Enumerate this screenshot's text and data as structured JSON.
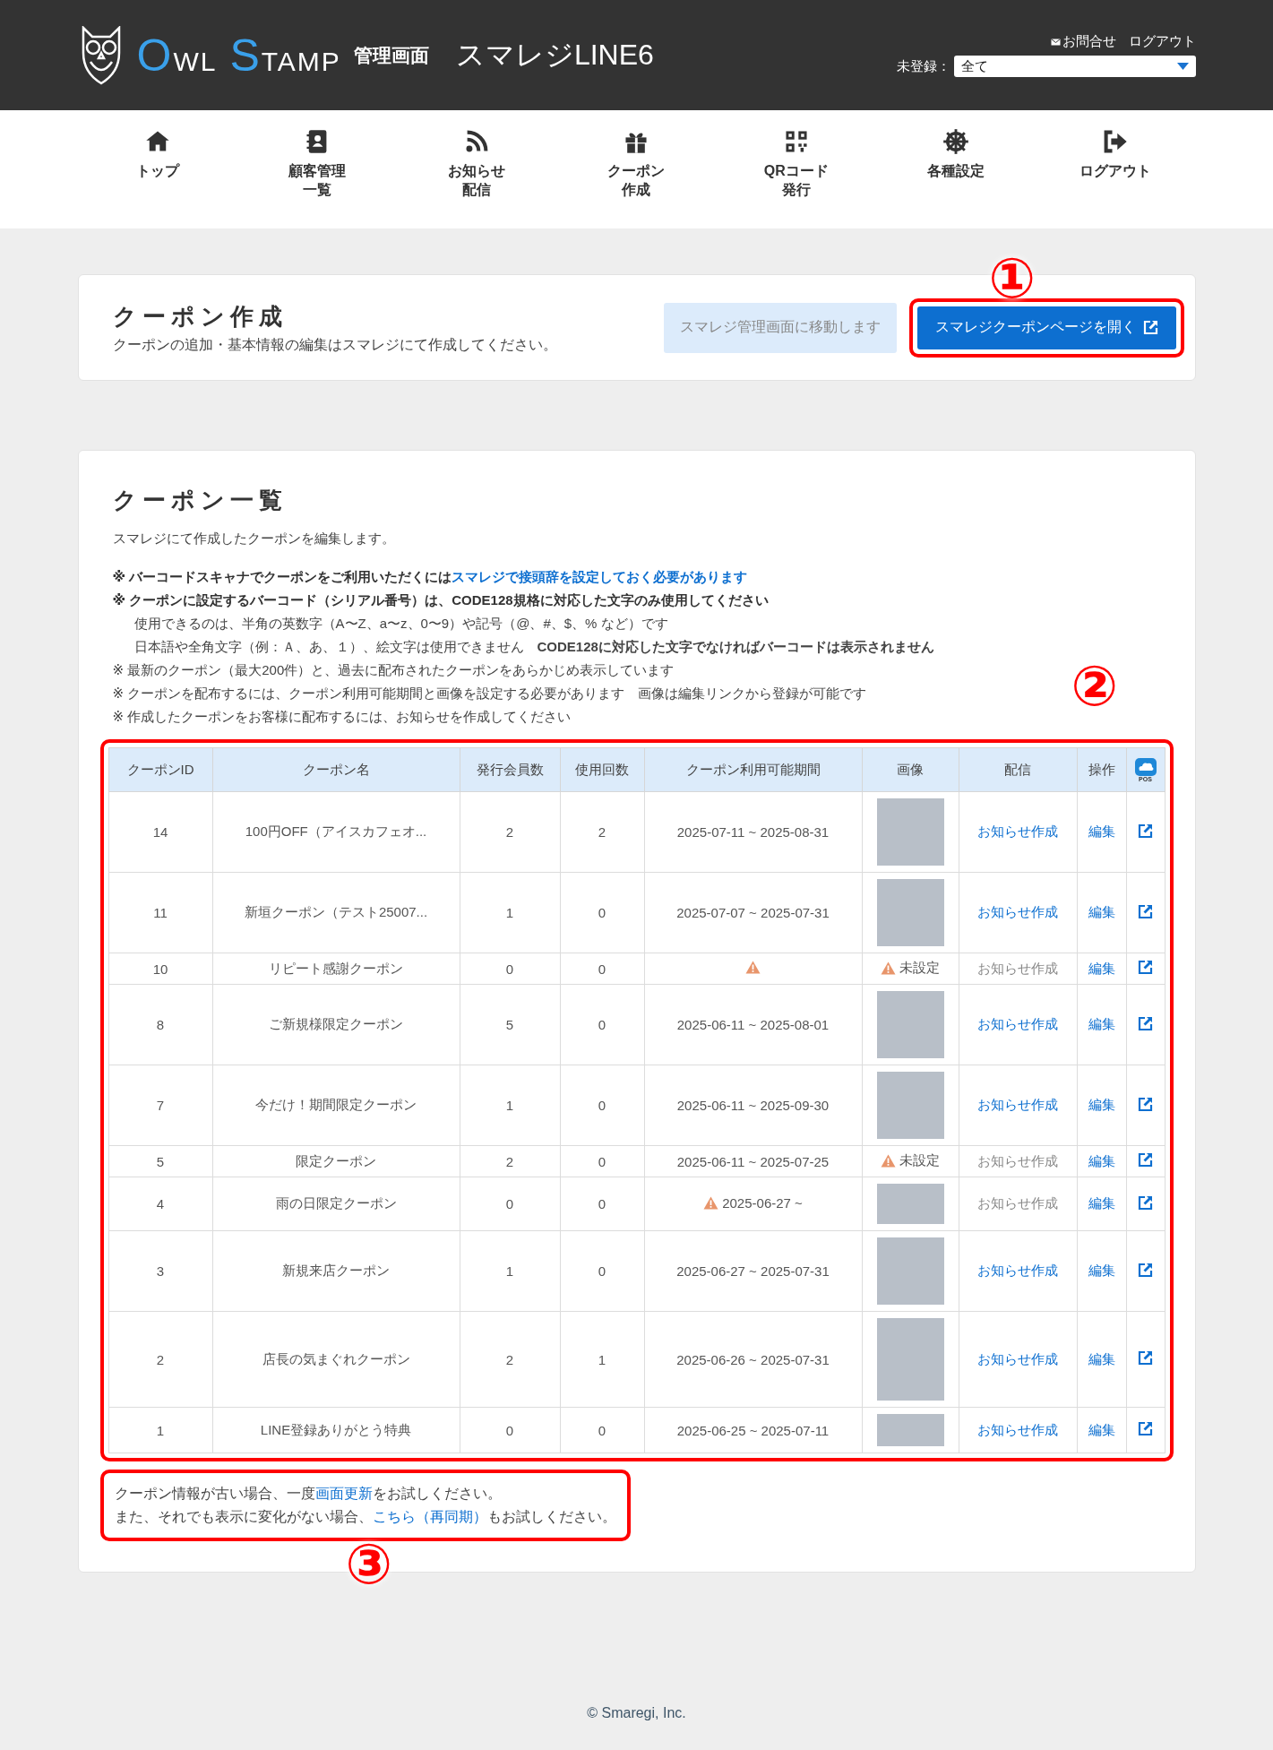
{
  "header": {
    "brand_words": [
      "OWL",
      "STAMP"
    ],
    "subtitle": "管理画面",
    "shop": "スマレジLINE6",
    "contact": "お問合せ",
    "logout": "ログアウト",
    "filter_label": "未登録：",
    "filter_value": "全て"
  },
  "nav": [
    {
      "lines": [
        "トップ"
      ]
    },
    {
      "lines": [
        "顧客管理",
        "一覧"
      ]
    },
    {
      "lines": [
        "お知らせ",
        "配信"
      ]
    },
    {
      "lines": [
        "クーポン",
        "作成"
      ]
    },
    {
      "lines": [
        "QRコード",
        "発行"
      ]
    },
    {
      "lines": [
        "各種設定"
      ]
    },
    {
      "lines": [
        "ログアウト"
      ]
    }
  ],
  "create_card": {
    "title": "クーポン作成",
    "description": "クーポンの追加・基本情報の編集はスマレジにて作成してください。",
    "buttons": [
      {
        "label": "スマレジ管理画面に移動します",
        "disabled": true
      },
      {
        "label": "スマレジクーポンページを開く",
        "disabled": false
      }
    ]
  },
  "list_card": {
    "title": "クーポン一覧",
    "description": "スマレジにて作成したクーポンを編集します。",
    "notes": [
      {
        "kind": "note",
        "text": "※ バーコードスキャナでクーポンをご利用いただくには",
        "link": "スマレジで接頭辞を設定しておく必要があります",
        "bold": true
      },
      {
        "kind": "note",
        "text": "※ クーポンに設定するバーコード（シリアル番号）は、CODE128規格に対応した文字のみ使用してください",
        "bold": true
      },
      {
        "kind": "sub",
        "text": "使用できるのは、半角の英数字（A〜Z、a〜z、0〜9）や記号（@、#、$、% など）です",
        "bold": false
      },
      {
        "kind": "sub",
        "text": "日本語や全角文字（例：Ａ、あ、１）、絵文字は使用できません　**CODE128に対応した文字でなければバーコードは表示されません**",
        "bold": false
      },
      {
        "kind": "note",
        "text": "※ 最新のクーポン（最大200件）と、過去に配布されたクーポンをあらかじめ表示しています",
        "bold": false
      },
      {
        "kind": "note",
        "text": "※ クーポンを配布するには、クーポン利用可能期間と画像を設定する必要があります　画像は編集リンクから登録が可能です",
        "bold": false
      },
      {
        "kind": "note",
        "text": "※ 作成したクーポンをお客様に配布するには、お知らせを作成してください",
        "bold": false
      }
    ],
    "table": {
      "columns": [
        "クーポンID",
        "クーポン名",
        "発行会員数",
        "使用回数",
        "クーポン利用可能期間",
        "画像",
        "配信",
        "操作"
      ],
      "pos_label": "POS",
      "rows": [
        {
          "id": "14",
          "name": "100円OFF（アイスカフェオ...",
          "issued": "2",
          "used": "2",
          "period": "2025-07-11 ~ 2025-08-31",
          "period_warning": false,
          "image": {
            "kind": "photo"
          },
          "notice": "お知らせ作成",
          "notice_disabled": false,
          "edit": "編集"
        },
        {
          "id": "11",
          "name": "新垣クーポン（テスト25007...",
          "issued": "1",
          "used": "0",
          "period": "2025-07-07 ~ 2025-07-31",
          "period_warning": false,
          "image": {
            "kind": "photo"
          },
          "notice": "お知らせ作成",
          "notice_disabled": false,
          "edit": "編集"
        },
        {
          "id": "10",
          "name": "リピート感謝クーポン",
          "issued": "0",
          "used": "0",
          "period_warning": true,
          "image": {
            "kind": "unset",
            "label": "未設定"
          },
          "notice": "お知らせ作成",
          "notice_disabled": true,
          "edit": "編集"
        },
        {
          "id": "8",
          "name": "ご新規様限定クーポン",
          "issued": "5",
          "used": "0",
          "period": "2025-06-11 ~ 2025-08-01",
          "period_warning": false,
          "image": {
            "kind": "photo"
          },
          "notice": "お知らせ作成",
          "notice_disabled": false,
          "edit": "編集"
        },
        {
          "id": "7",
          "name": "今だけ！期間限定クーポン",
          "issued": "1",
          "used": "0",
          "period": "2025-06-11 ~ 2025-09-30",
          "period_warning": false,
          "image": {
            "kind": "photo"
          },
          "notice": "お知らせ作成",
          "notice_disabled": false,
          "edit": "編集"
        },
        {
          "id": "5",
          "name": "限定クーポン",
          "issued": "2",
          "used": "0",
          "period": "2025-06-11 ~ 2025-07-25",
          "period_warning": false,
          "image": {
            "kind": "unset",
            "label": "未設定"
          },
          "notice": "お知らせ作成",
          "notice_disabled": true,
          "edit": "編集"
        },
        {
          "id": "4",
          "name": "雨の日限定クーポン",
          "issued": "0",
          "used": "0",
          "period": "2025-06-27 ~",
          "period_warning": true,
          "image": {
            "kind": "banner"
          },
          "notice": "お知らせ作成",
          "notice_disabled": true,
          "edit": "編集"
        },
        {
          "id": "3",
          "name": "新規来店クーポン",
          "issued": "1",
          "used": "0",
          "period": "2025-06-27 ~ 2025-07-31",
          "period_warning": false,
          "image": {
            "kind": "photo"
          },
          "notice": "お知らせ作成",
          "notice_disabled": false,
          "edit": "編集"
        },
        {
          "id": "2",
          "name": "店長の気まぐれクーポン",
          "issued": "2",
          "used": "1",
          "period": "2025-06-26 ~ 2025-07-31",
          "period_warning": false,
          "image": {
            "kind": "poster"
          },
          "notice": "お知らせ作成",
          "notice_disabled": false,
          "edit": "編集"
        },
        {
          "id": "1",
          "name": "LINE登録ありがとう特典",
          "issued": "0",
          "used": "0",
          "period": "2025-06-25 ~ 2025-07-11",
          "period_warning": false,
          "image": {
            "kind": "cropped"
          },
          "notice": "お知らせ作成",
          "notice_disabled": false,
          "edit": "編集"
        }
      ]
    },
    "help": [
      {
        "before": "クーポン情報が古い場合、一度",
        "link": "画面更新",
        "after": "をお試しください。"
      },
      {
        "before": "また、それでも表示に変化がない場合、",
        "link": "こちら（再同期）",
        "after": "もお試しください。"
      }
    ]
  },
  "annotations": [
    {
      "label": "①"
    },
    {
      "label": "②"
    },
    {
      "label": "③"
    }
  ],
  "footer": {
    "copyright": "© Smaregi, Inc."
  }
}
